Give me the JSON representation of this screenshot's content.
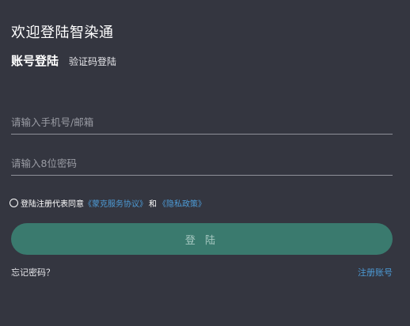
{
  "page": {
    "title": "欢迎登陆智染通"
  },
  "tabs": {
    "account_login": "账号登陆",
    "code_login": "验证码登陆"
  },
  "form": {
    "phone_placeholder": "请输入手机号/邮箱",
    "password_placeholder": "请输入8位密码"
  },
  "agreement": {
    "prefix": "登陆注册代表同意",
    "terms_link": "《蒙克服务协议》",
    "and": "和",
    "privacy_link": "《隐私政策》"
  },
  "actions": {
    "login_label": "登 陆",
    "forgot_password": "忘记密码？",
    "register": "注册账号"
  },
  "colors": {
    "background": "#343640",
    "accent_button": "#3a7a6e",
    "link": "#4d9bd6"
  }
}
